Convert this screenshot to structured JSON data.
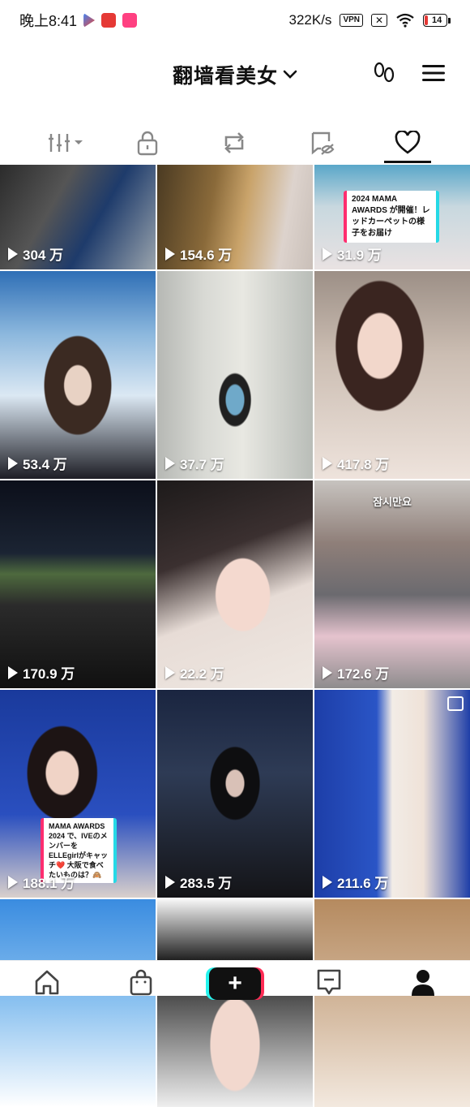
{
  "status_bar": {
    "time": "晚上8:41",
    "network_speed": "322K/s",
    "vpn_label": "VPN",
    "battery": "14",
    "battery_level": 0.14
  },
  "header": {
    "title": "翻墙看美女",
    "icons": [
      "footprints-icon",
      "menu-icon"
    ]
  },
  "tabs": [
    {
      "name": "tab-grid",
      "icon": "grid-filter-icon"
    },
    {
      "name": "tab-private",
      "icon": "lock-icon"
    },
    {
      "name": "tab-reposts",
      "icon": "repost-icon"
    },
    {
      "name": "tab-tagged",
      "icon": "tag-hidden-icon"
    },
    {
      "name": "tab-liked",
      "icon": "heart-icon",
      "active": true
    }
  ],
  "videos": [
    {
      "views": "304 万"
    },
    {
      "views": "154.6 万"
    },
    {
      "views": "31.9 万",
      "caption": "2024 MAMA AWARDS が開催！レッドカーペットの様子をお届け"
    },
    {
      "views": "53.4 万"
    },
    {
      "views": "37.7 万"
    },
    {
      "views": "417.8 万"
    },
    {
      "views": "170.9 万"
    },
    {
      "views": "22.2 万"
    },
    {
      "views": "172.6 万",
      "overlay_text": "잠시만요"
    },
    {
      "views": "188.1 万",
      "caption": "MAMA AWARDS 2024 で、IVEのメンバーを ELLEgirlがキャッチ❤️ 大阪で食べたいものは？🙈"
    },
    {
      "views": "283.5 万"
    },
    {
      "views": "211.6 万",
      "multi_image": true
    },
    {
      "views": ""
    },
    {
      "views": ""
    },
    {
      "views": ""
    }
  ],
  "bottom_nav": {
    "items": [
      "home-icon",
      "shop-icon",
      "create-icon",
      "inbox-icon",
      "profile-icon"
    ],
    "create_label": "+"
  },
  "colors": {
    "accent_pink": "#fe2c55",
    "accent_cyan": "#25f4ee"
  }
}
